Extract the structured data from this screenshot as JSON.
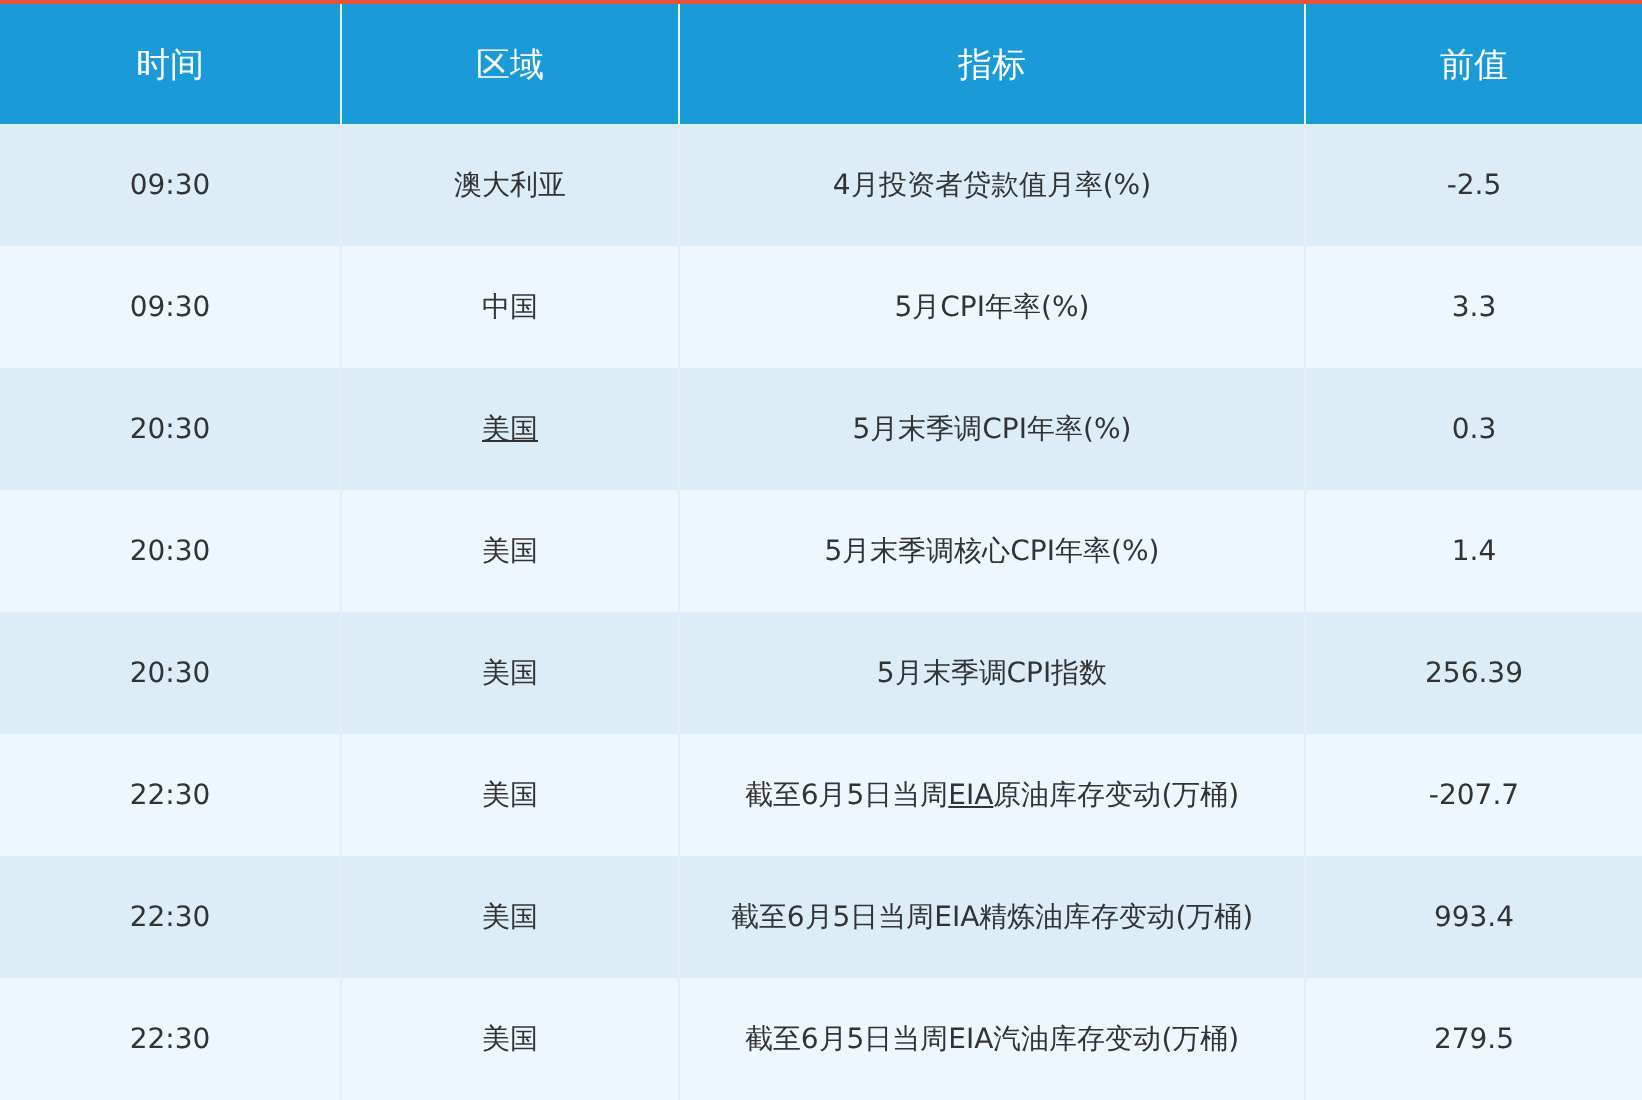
{
  "table": {
    "columns": [
      "时间",
      "区域",
      "指标",
      "前值"
    ],
    "rows": [
      {
        "time": "09:30",
        "region": {
          "text": "澳大利亚",
          "link": false
        },
        "indicator": [
          {
            "text": "4月投资者贷款值月率(%)",
            "link": false
          }
        ],
        "previous": "-2.5"
      },
      {
        "time": "09:30",
        "region": {
          "text": "中国",
          "link": false
        },
        "indicator": [
          {
            "text": "5月CPI年率(%)",
            "link": false
          }
        ],
        "previous": "3.3"
      },
      {
        "time": "20:30",
        "region": {
          "text": "美国",
          "link": true
        },
        "indicator": [
          {
            "text": "5月末季调CPI年率(%)",
            "link": false
          }
        ],
        "previous": "0.3"
      },
      {
        "time": "20:30",
        "region": {
          "text": "美国",
          "link": false
        },
        "indicator": [
          {
            "text": "5月末季调核心CPI年率(%)",
            "link": false
          }
        ],
        "previous": "1.4"
      },
      {
        "time": "20:30",
        "region": {
          "text": "美国",
          "link": false
        },
        "indicator": [
          {
            "text": "5月末季调CPI指数",
            "link": false
          }
        ],
        "previous": "256.39"
      },
      {
        "time": "22:30",
        "region": {
          "text": "美国",
          "link": false
        },
        "indicator": [
          {
            "text": "截至6月5日当周",
            "link": false
          },
          {
            "text": "EIA",
            "link": true
          },
          {
            "text": "原油库存变动(万桶)",
            "link": false
          }
        ],
        "previous": "-207.7"
      },
      {
        "time": "22:30",
        "region": {
          "text": "美国",
          "link": false
        },
        "indicator": [
          {
            "text": "截至6月5日当周EIA精炼油库存变动(万桶)",
            "link": false
          }
        ],
        "previous": "993.4"
      },
      {
        "time": "22:30",
        "region": {
          "text": "美国",
          "link": false
        },
        "indicator": [
          {
            "text": "截至6月5日当周EIA汽油库存变动(万桶)",
            "link": false
          }
        ],
        "previous": "279.5"
      }
    ]
  }
}
